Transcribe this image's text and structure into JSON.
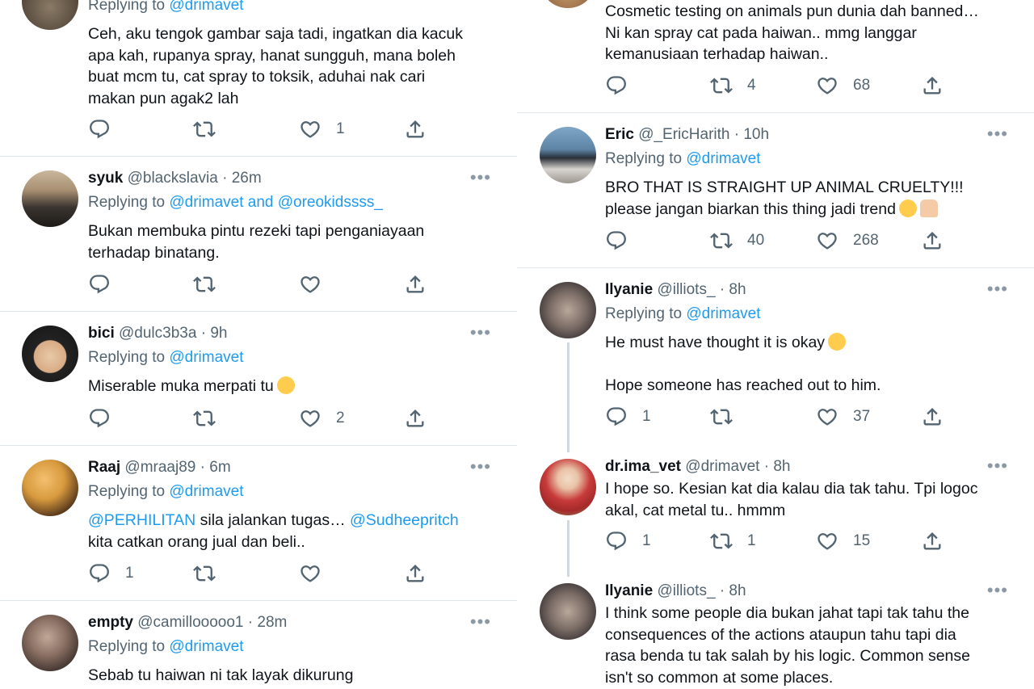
{
  "colors": {
    "text": "#0f1419",
    "secondary": "#536471",
    "link": "#1d9bf0",
    "divider": "#e1e6ea",
    "thread_line": "#cfd9de"
  },
  "left": {
    "tweets": [
      {
        "replying_label": "Replying to",
        "replying_to": "@drimavet",
        "lines": [
          "Ceh, aku tengok gambar saja tadi, ingatkan dia kacuk",
          "apa kah, rupanya spray, hanat sungguh, mana boleh",
          "buat mcm tu, cat spray to toksik, aduhai nak cari",
          "makan pun agak2 lah"
        ],
        "replies": "",
        "retweets": "",
        "likes": "1"
      },
      {
        "name": "syuk",
        "handle": "@blackslavia",
        "time": "· 26m",
        "replying_label": "Replying to",
        "replying_to": "@drimavet and @oreokidssss_",
        "lines": [
          "Bukan membuka pintu rezeki tapi penganiayaan",
          "terhadap binatang."
        ],
        "replies": "",
        "retweets": "",
        "likes": ""
      },
      {
        "name": "bici",
        "handle": "@dulc3b3a",
        "time": "· 9h",
        "replying_label": "Replying to",
        "replying_to": "@drimavet",
        "lines": [
          "Miserable muka merpati tu"
        ],
        "emoji": "pleading-face-emoji",
        "replies": "",
        "retweets": "",
        "likes": "2"
      },
      {
        "name": "Raaj",
        "handle": "@mraaj89",
        "time": "· 6m",
        "replying_label": "Replying to",
        "replying_to": "@drimavet",
        "mention_1": "@PERHILITAN",
        "text_mid": " sila jalankan tugas… ",
        "mention_2": "@Sudheepritch",
        "lines": [
          "kita catkan orang jual dan beli.."
        ],
        "replies": "1",
        "retweets": "",
        "likes": ""
      },
      {
        "name": "empty",
        "handle": "@camillooooo1",
        "time": "· 28m",
        "replying_label": "Replying to",
        "replying_to": "@drimavet",
        "lines": [
          "Sebab tu haiwan ni tak layak dikurung"
        ]
      }
    ]
  },
  "right": {
    "tweets": [
      {
        "lines": [
          "Cosmetic testing on animals pun dunia dah banned…",
          "Ni kan spray cat pada haiwan.. mmg langgar",
          "kemanusiaan terhadap haiwan.."
        ],
        "replies": "",
        "retweets": "4",
        "likes": "68"
      },
      {
        "name": "Eric",
        "handle": "@_EricHarith",
        "time": "· 10h",
        "replying_label": "Replying to",
        "replying_to": "@drimavet",
        "lines": [
          "BRO THAT IS STRAIGHT UP ANIMAL CRUELTY!!!",
          "please jangan biarkan this thing jadi trend"
        ],
        "emoji": [
          "loudly-crying-face-emoji",
          "folded-hands-emoji"
        ],
        "replies": "",
        "retweets": "40",
        "likes": "268"
      },
      {
        "name": "Ilyanie",
        "handle": "@illiots_",
        "time": "· 8h",
        "replying_label": "Replying to",
        "replying_to": "@drimavet",
        "lines": [
          "He must have thought it is okay",
          "",
          "Hope someone has reached out to him."
        ],
        "emoji": "loudly-crying-face-emoji",
        "replies": "1",
        "retweets": "",
        "likes": "37"
      },
      {
        "name": "dr.ima_vet",
        "handle": "@drimavet",
        "time": "· 8h",
        "lines": [
          "I hope so. Kesian kat dia kalau dia tak tahu. Tpi logoc",
          "akal, cat metal tu.. hmmm"
        ],
        "replies": "1",
        "retweets": "1",
        "likes": "15"
      },
      {
        "name": "Ilyanie",
        "handle": "@illiots_",
        "time": "· 8h",
        "lines": [
          "I think some people dia bukan jahat tapi tak tahu the",
          "consequences of the actions ataupun tahu tapi dia",
          "rasa benda tu tak salah by his logic. Common sense",
          "isn't so common at some places."
        ]
      }
    ]
  }
}
